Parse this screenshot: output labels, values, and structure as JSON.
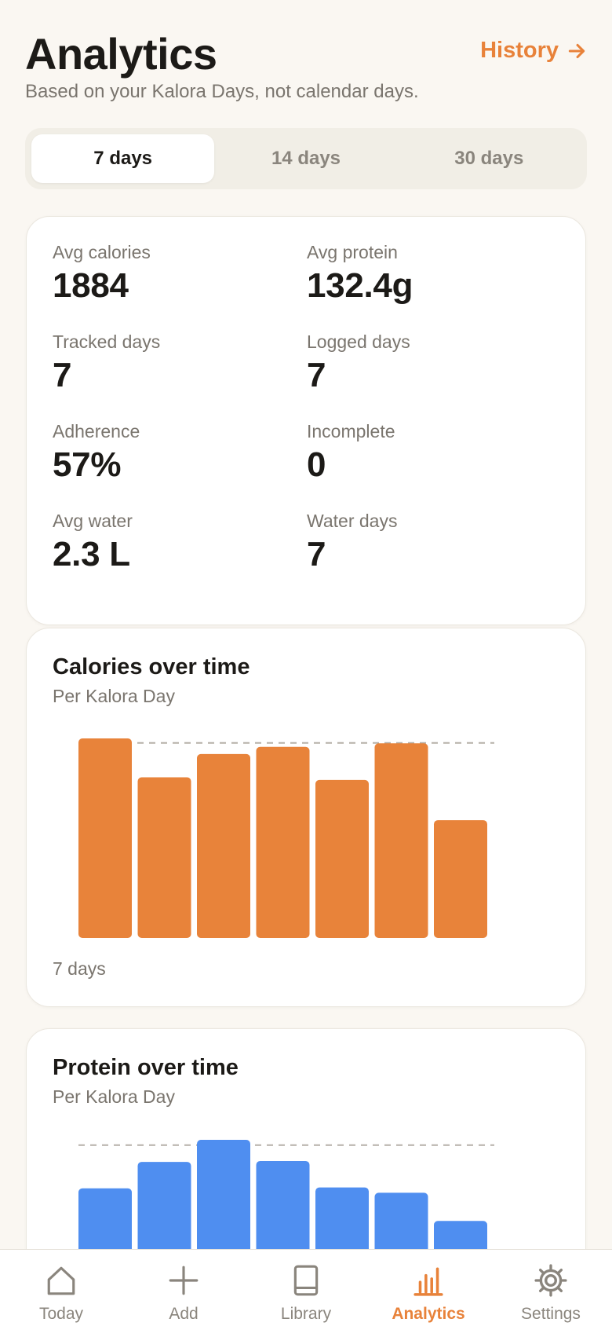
{
  "header": {
    "title": "Analytics",
    "history_label": "History",
    "subtitle": "Based on your Kalora Days, not calendar days."
  },
  "range": {
    "options": [
      "7 days",
      "14 days",
      "30 days"
    ],
    "selected": "7 days"
  },
  "stats": [
    {
      "label": "Avg calories",
      "value": "1884"
    },
    {
      "label": "Avg protein",
      "value": "132.4g"
    },
    {
      "label": "Tracked days",
      "value": "7"
    },
    {
      "label": "Logged days",
      "value": "7"
    },
    {
      "label": "Adherence",
      "value": "57%"
    },
    {
      "label": "Incomplete",
      "value": "0"
    },
    {
      "label": "Avg water",
      "value": "2.3 L"
    },
    {
      "label": "Water days",
      "value": "7"
    }
  ],
  "calories_chart": {
    "title": "Calories over time",
    "subtitle": "Per Kalora Day",
    "footer": "7 days",
    "color": "#e8833a"
  },
  "protein_chart": {
    "title": "Protein over time",
    "subtitle": "Per Kalora Day",
    "color": "#4f8ef0"
  },
  "chart_data": [
    {
      "type": "bar",
      "title": "Calories over time",
      "subtitle": "Per Kalora Day",
      "values": [
        2180,
        1745,
        2005,
        2085,
        1715,
        2125,
        1265
      ],
      "target": 2130,
      "ylim": [
        0,
        2180
      ],
      "xlabel": "7 days",
      "grid": false,
      "color": "#e8833a"
    },
    {
      "type": "bar",
      "title": "Protein over time",
      "subtitle": "Per Kalora Day",
      "values": [
        116,
        146,
        171,
        147,
        117,
        111,
        79
      ],
      "target": 165,
      "ylim": [
        0,
        171
      ],
      "grid": false,
      "color": "#4f8ef0"
    }
  ],
  "tabbar": {
    "items": [
      {
        "label": "Today",
        "icon": "house-icon"
      },
      {
        "label": "Add",
        "icon": "plus-icon"
      },
      {
        "label": "Library",
        "icon": "book-icon"
      },
      {
        "label": "Analytics",
        "icon": "bar-chart-icon"
      },
      {
        "label": "Settings",
        "icon": "gear-icon"
      }
    ],
    "active": "Analytics",
    "accent": "#e8823a"
  }
}
